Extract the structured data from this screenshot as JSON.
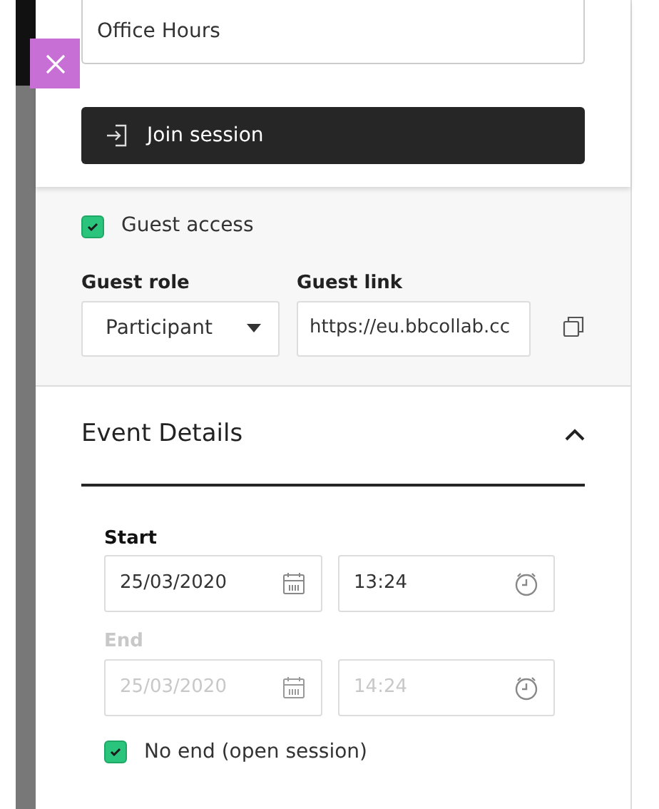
{
  "session_name": {
    "value": "Office Hours"
  },
  "join_button": {
    "label": "Join session"
  },
  "guest_access": {
    "label": "Guest access",
    "checked": true
  },
  "guest_role": {
    "label": "Guest role",
    "value": "Participant"
  },
  "guest_link": {
    "label": "Guest link",
    "value": "https://eu.bbcollab.cc"
  },
  "event_details": {
    "title": "Event Details",
    "expanded": true,
    "times": [
      {
        "label": "Start",
        "date": "25/03/2020",
        "time": "13:24",
        "disabled": false
      },
      {
        "label": "End",
        "date": "25/03/2020",
        "time": "14:24",
        "disabled": true
      }
    ],
    "no_end": {
      "label": "No end (open session)",
      "checked": true
    }
  }
}
